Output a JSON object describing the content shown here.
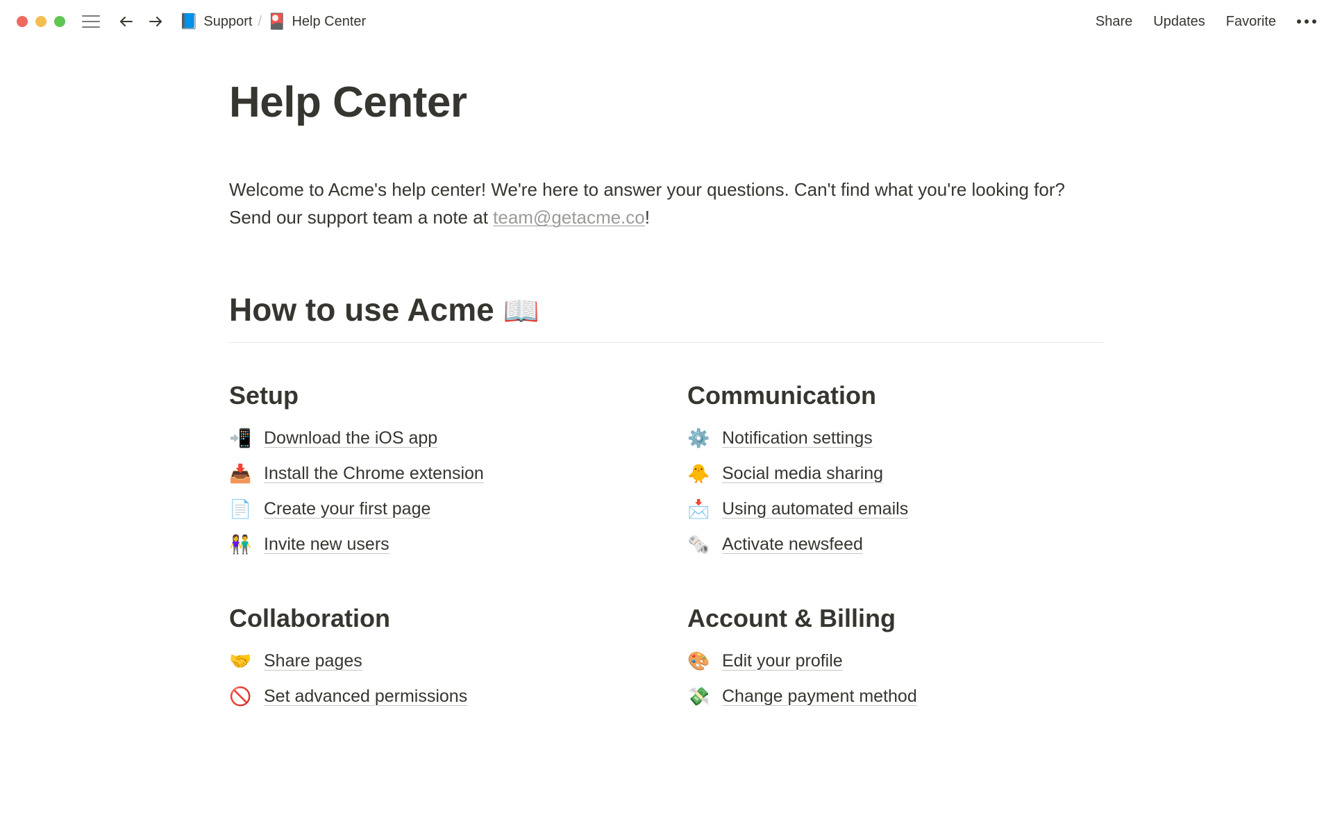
{
  "topbar": {
    "breadcrumb": [
      {
        "icon": "📘",
        "label": "Support"
      },
      {
        "icon": "🎴",
        "label": "Help Center"
      }
    ],
    "actions": {
      "share": "Share",
      "updates": "Updates",
      "favorite": "Favorite"
    }
  },
  "page": {
    "title": "Help Center",
    "intro_pre": "Welcome to Acme's help center! We're here to answer your questions. Can't find what you're looking for? Send our support team a note at ",
    "intro_link": "team@getacme.co",
    "intro_post": "!",
    "section_heading": "How to use Acme ",
    "section_heading_emoji": "📖"
  },
  "columns": {
    "setup": {
      "title": "Setup",
      "items": [
        {
          "icon": "📲",
          "label": "Download the iOS app"
        },
        {
          "icon": "📥",
          "label": "Install the Chrome extension"
        },
        {
          "icon": "📄",
          "label": "Create your first page"
        },
        {
          "icon": "👫",
          "label": "Invite new users"
        }
      ]
    },
    "communication": {
      "title": "Communication",
      "items": [
        {
          "icon": "⚙️",
          "label": "Notification settings"
        },
        {
          "icon": "🐥",
          "label": "Social media sharing"
        },
        {
          "icon": "📩",
          "label": "Using automated emails"
        },
        {
          "icon": "🗞️",
          "label": "Activate newsfeed"
        }
      ]
    },
    "collaboration": {
      "title": "Collaboration",
      "items": [
        {
          "icon": "🤝",
          "label": "Share pages"
        },
        {
          "icon": "🚫",
          "label": "Set advanced permissions"
        }
      ]
    },
    "account": {
      "title": "Account & Billing",
      "items": [
        {
          "icon": "🎨",
          "label": "Edit your profile"
        },
        {
          "icon": "💸",
          "label": "Change payment method"
        }
      ]
    }
  }
}
